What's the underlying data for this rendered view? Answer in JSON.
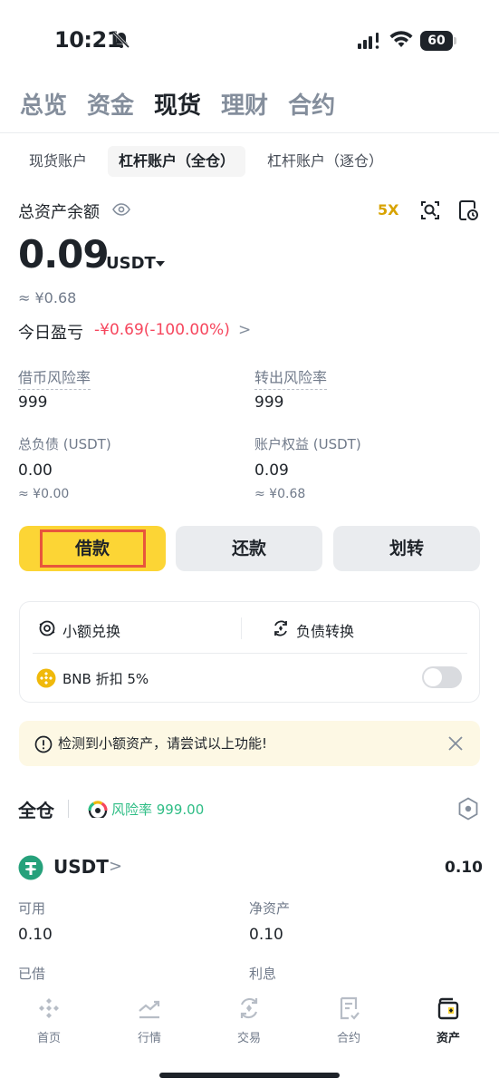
{
  "status": {
    "time": "10:21",
    "battery": "60"
  },
  "nav": [
    "总览",
    "资金",
    "现货",
    "理财",
    "合约"
  ],
  "nav_active": "现货",
  "subtabs": [
    "现货账户",
    "杠杆账户（全仓）",
    "杠杆账户（逐仓）"
  ],
  "summary": {
    "label": "总资产余额",
    "leverage": "5X",
    "balance": "0.09",
    "unit": "USDT",
    "approx": "≈ ¥0.68",
    "pnl_label": "今日盈亏",
    "pnl_value": "-¥0.69(-100.00%)",
    "pnl_arrow": ">"
  },
  "stats": {
    "borrow_risk_label": "借币风险率",
    "borrow_risk_value": "999",
    "transfer_risk_label": "转出风险率",
    "transfer_risk_value": "999",
    "total_debt_label": "总负债 (USDT)",
    "total_debt_value": "0.00",
    "total_debt_approx": "≈ ¥0.00",
    "equity_label": "账户权益 (USDT)",
    "equity_value": "0.09",
    "equity_approx": "≈ ¥0.68"
  },
  "buttons": {
    "borrow": "借款",
    "repay": "还款",
    "transfer": "划转"
  },
  "tools": {
    "small_convert": "小额兑换",
    "debt_convert": "负债转换",
    "bnb_discount": "BNB 折扣 5%",
    "bnb_toggle_on": false
  },
  "notice": {
    "text": "检测到小额资产，请尝试以上功能!"
  },
  "cross": {
    "title": "全仓",
    "risk": "风险率 999.00"
  },
  "asset": {
    "name": "USDT",
    "chevron": ">",
    "value": "0.10",
    "available_label": "可用",
    "available_value": "0.10",
    "net_label": "净资产",
    "net_value": "0.10",
    "borrowed_label": "已借",
    "interest_label": "利息"
  },
  "tabbar": [
    {
      "label": "首页",
      "icon": "home-icon"
    },
    {
      "label": "行情",
      "icon": "markets-icon"
    },
    {
      "label": "交易",
      "icon": "trade-icon"
    },
    {
      "label": "合约",
      "icon": "futures-icon"
    },
    {
      "label": "资产",
      "icon": "wallet-icon"
    }
  ],
  "colors": {
    "accent": "#fcd535",
    "loss": "#f6465d",
    "gain": "#2ebd85",
    "highlight": "#e8553c"
  }
}
